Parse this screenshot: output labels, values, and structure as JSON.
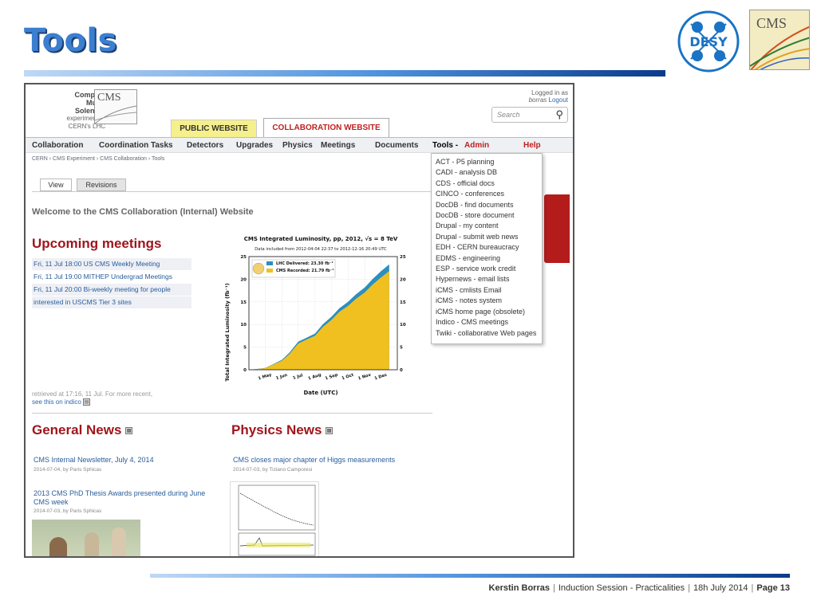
{
  "slide": {
    "title": "Tools",
    "footer": {
      "author": "Kerstin Borras",
      "session": "Induction Session - Practicalities",
      "date": "18h  July 2014",
      "page": "Page 13"
    },
    "logos": {
      "desy": "DESY",
      "cms": "CMS"
    }
  },
  "site": {
    "brand": [
      "Compact",
      "Muon",
      "Solenoid"
    ],
    "brand_sub": [
      "experiment at",
      "CERN's LHC"
    ],
    "cms_mark": "CMS",
    "login": {
      "line1": "Logged in as",
      "user": "borras",
      "logout": "Logout"
    },
    "search_placeholder": "Search",
    "tabs": {
      "public": "PUBLIC WEBSITE",
      "collab": "COLLABORATION WEBSITE"
    },
    "nav": [
      "Collaboration",
      "Coordination Tasks",
      "Detectors",
      "Upgrades",
      "Physics",
      "Meetings",
      "Documents",
      "Tools -",
      "Admin",
      "Help"
    ],
    "breadcrumb": "CERN › CMS Experiment › CMS Collaboration › Tools",
    "tools_menu": [
      "ACT - P5 planning",
      "CADI - analysis DB",
      "CDS - official docs",
      "CINCO - conferences",
      "DocDB - find documents",
      "DocDB - store document",
      "Drupal - my content",
      "Drupal - submit web news",
      "EDH - CERN bureaucracy",
      "EDMS - engineering",
      "ESP - service work credit",
      "Hypernews - email lists",
      "iCMS - cmlists Email",
      "iCMS - notes system",
      "iCMS home page (obsolete)",
      "Indico - CMS meetings",
      "Twiki - collaborative Web pages"
    ],
    "view_tabs": [
      "View",
      "Revisions"
    ],
    "welcome": "Welcome to the CMS Collaboration (Internal) Website",
    "meetings_heading": "Upcoming meetings",
    "meetings": [
      "Fri, 11 Jul 18:00 US CMS Weekly Meeting",
      "Fri, 11 Jul 19:00 MITHEP Undergrad Meetings",
      "Fri, 11 Jul 20:00 Bi-weekly meeting for people",
      "interested in USCMS Tier 3 sites"
    ],
    "retrieved": "retrieved at 17:16, 11 Jul. For more recent,",
    "retrieved_link": "see this on indico",
    "general_news_heading": "General News",
    "physics_news_heading": "Physics News",
    "general_news": [
      {
        "title": "CMS Internal Newsletter, July 4, 2014",
        "meta": "2014-07-04, by Paris Sphicas"
      },
      {
        "title": "2013 CMS PhD Thesis Awards presented during June CMS week",
        "meta": "2014-07-03, by Paris Sphicas"
      }
    ],
    "physics_news": [
      {
        "title": "CMS closes major chapter of Higgs measurements",
        "meta": "2014-07-03, by Tiziano Camporesi"
      }
    ]
  },
  "chart_data": {
    "type": "area",
    "title": "CMS Integrated Luminosity, pp, 2012, √s = 8 TeV",
    "subtitle": "Data included from 2012-04-04 22:37 to 2012-12-16 20:49 UTC",
    "xlabel": "Date (UTC)",
    "ylabel": "Total Integrated Luminosity (fb⁻¹)",
    "x_ticks": [
      "1 May",
      "1 Jun",
      "1 Jul",
      "1 Aug",
      "1 Sep",
      "1 Oct",
      "1 Nov",
      "1 Dec"
    ],
    "y_ticks": [
      0,
      5,
      10,
      15,
      20,
      25
    ],
    "ylim": [
      0,
      25
    ],
    "x": [
      "2012-04-04",
      "2012-05-01",
      "2012-05-15",
      "2012-06-01",
      "2012-06-15",
      "2012-07-01",
      "2012-07-15",
      "2012-08-01",
      "2012-08-15",
      "2012-09-01",
      "2012-09-15",
      "2012-10-01",
      "2012-10-15",
      "2012-11-01",
      "2012-11-15",
      "2012-12-01",
      "2012-12-16"
    ],
    "series": [
      {
        "name": "LHC Delivered: 23.30 fb⁻¹",
        "color": "#2b8fc0",
        "values": [
          0,
          0.4,
          1.2,
          2.2,
          3.8,
          6.2,
          7.0,
          8.0,
          10.0,
          11.8,
          13.6,
          15.0,
          16.6,
          18.2,
          20.0,
          21.8,
          23.3
        ]
      },
      {
        "name": "CMS Recorded: 21.79 fb⁻¹",
        "color": "#f0c020",
        "values": [
          0,
          0.35,
          1.1,
          2.0,
          3.5,
          5.8,
          6.6,
          7.5,
          9.4,
          11.1,
          12.8,
          14.1,
          15.6,
          17.1,
          18.8,
          20.4,
          21.79
        ]
      }
    ],
    "grid": true,
    "legend": "top-left"
  }
}
